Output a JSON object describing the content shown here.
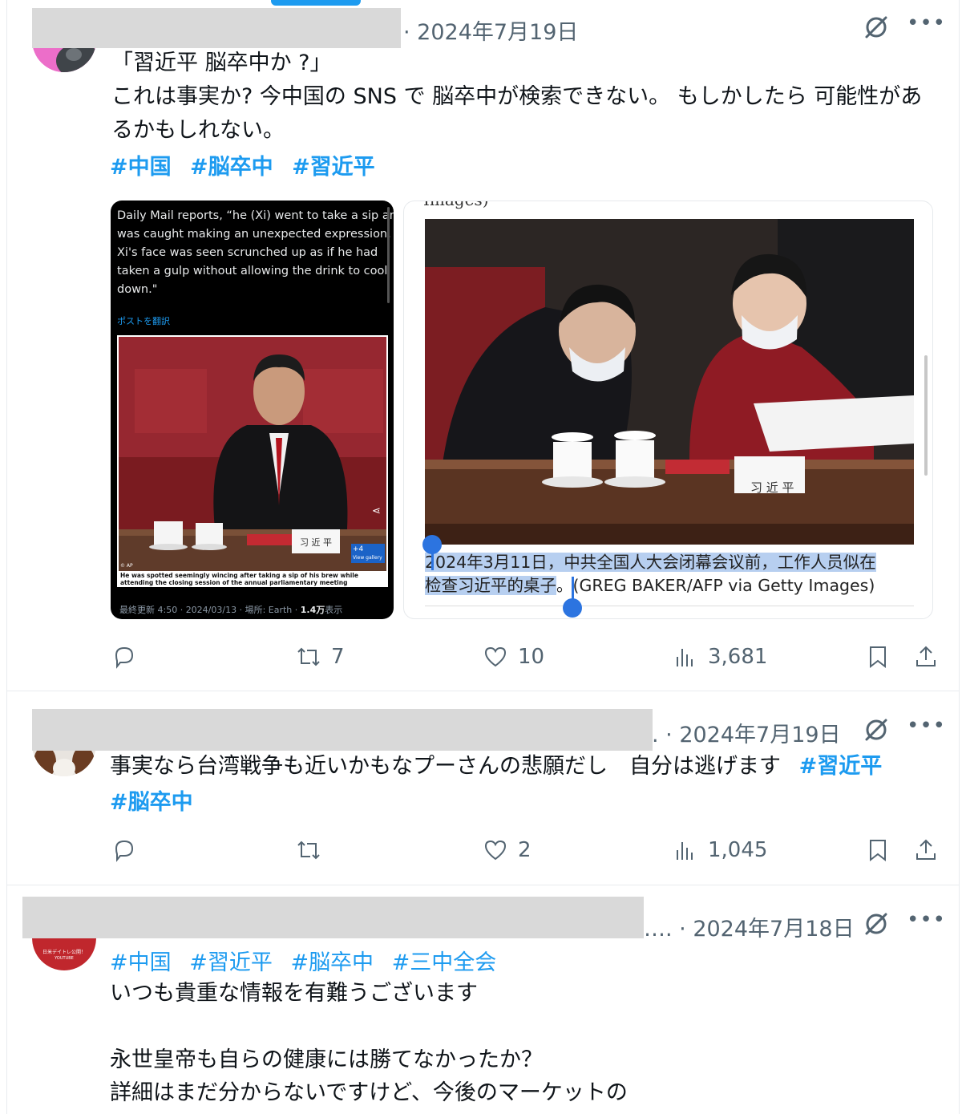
{
  "posts": [
    {
      "date": "· 2024年7月19日",
      "lines": [
        "「習近平 脳卒中か ?」",
        "これは事実か? 今中国の SNS で 脳卒中が検索できない。 もしかしたら 可能性があ",
        "るかもしれない。"
      ],
      "hashtags": [
        "#中国",
        "#脳卒中",
        "#習近平"
      ],
      "actions": {
        "reply": "",
        "repost": "7",
        "like": "10",
        "views": "3,681"
      }
    },
    {
      "date": ". · 2024年7月19日",
      "lines": [
        "事実なら台湾戦争も近いかもなプーさんの悲願だし　自分は逃げます"
      ],
      "hashtags_inline": [
        "#習近平"
      ],
      "hashtags": [
        "#脳卒中"
      ],
      "actions": {
        "reply": "",
        "repost": "",
        "like": "2",
        "views": "1,045"
      }
    },
    {
      "date": "…. · 2024年7月18日",
      "hashtags": [
        "#中国",
        "#習近平",
        "#脳卒中",
        "#三中全会"
      ],
      "lines": [
        "いつも貴重な情報を有難うございます",
        "",
        "永世皇帝も自らの健康には勝てなかったか？",
        "詳細はまだ分からないですけど、今後のマーケットの"
      ],
      "avatar_text": "日米デイトレ公開！",
      "avatar_sub": "YOUTUBE"
    }
  ],
  "media1": {
    "quote_lines": [
      "Daily Mail reports, “he (Xi) went to take a sip and",
      "was caught making an unexpected expression.",
      "Xi's face was seen scrunched up as if he had",
      "taken a gulp without allowing the drink to cool",
      "down.\""
    ],
    "translate": "ポストを翻訳",
    "caption": "He was spotted seemingly wincing after taking a sip of his brew while attending the closing session of the annual parliamentary meeting",
    "nameplate": "习 近 平",
    "gallery_count": "+4",
    "gallery_label": "View gallery",
    "credit": "© AP",
    "footer_prefix": "最終更新 4:50 · 2024/03/13 · 場所: Earth · ",
    "footer_views": "1.4万",
    "footer_suffix": "表示"
  },
  "media2": {
    "top_text": "Images)",
    "nameplate": "习 近 平",
    "caption_selected_1": "2024年3月11日，中共全国人大会闭幕会议前，工作人员似在",
    "caption_selected_2": "检查习近平的桌子",
    "caption_rest": "。(GREG BAKER/AFP via Getty Images)"
  },
  "colors": {
    "accent": "#1d9bf0",
    "muted": "#536471",
    "selection": "#b7cff0",
    "handle": "#2c74e0"
  },
  "icons": [
    "grok-icon",
    "more-icon",
    "reply-icon",
    "repost-icon",
    "like-icon",
    "views-icon",
    "bookmark-icon",
    "share-icon"
  ]
}
